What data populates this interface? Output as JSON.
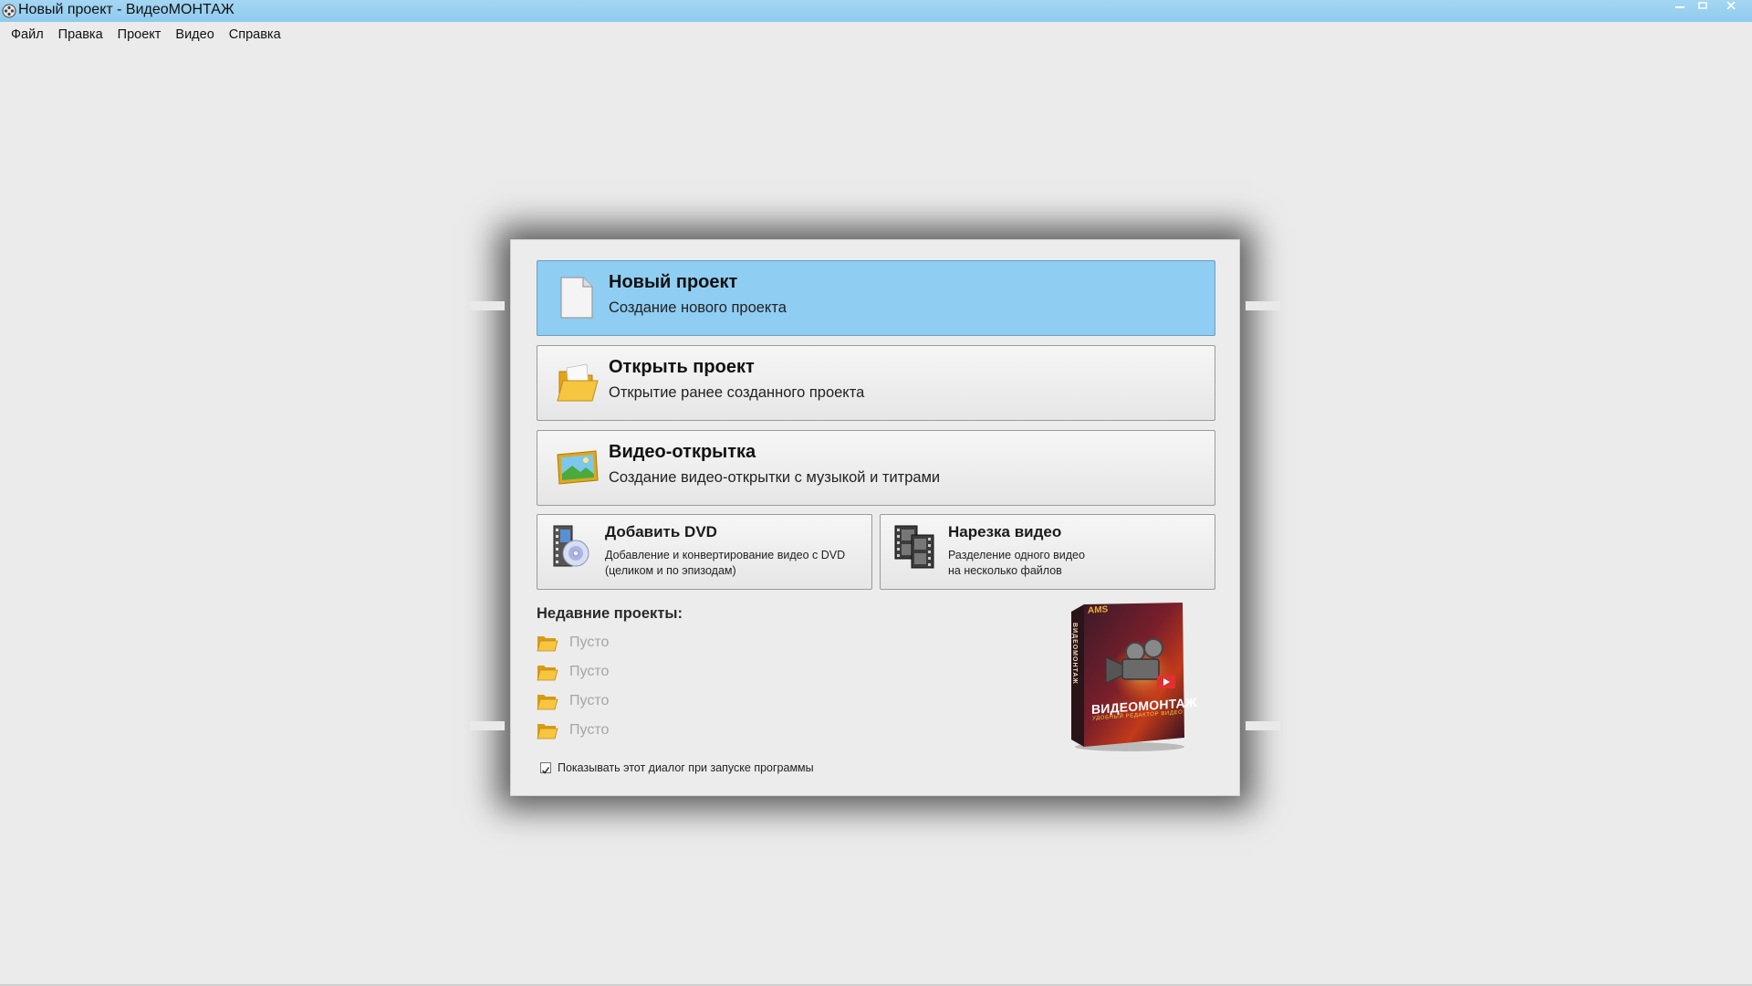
{
  "window": {
    "title": "Новый проект - ВидеоМОНТАЖ"
  },
  "menu": [
    {
      "label": "Файл"
    },
    {
      "label": "Правка"
    },
    {
      "label": "Проект"
    },
    {
      "label": "Видео"
    },
    {
      "label": "Справка"
    }
  ],
  "dialog": {
    "new_project": {
      "title": "Новый проект",
      "subtitle": "Создание нового проекта",
      "icon": "blank-document-icon",
      "selected": true
    },
    "open_project": {
      "title": "Открыть проект",
      "subtitle": "Открытие ранее созданного проекта",
      "icon": "folder-icon"
    },
    "video_card": {
      "title": "Видео-открытка",
      "subtitle": "Создание видео-открытки с музыкой и титрами",
      "icon": "picture-icon"
    },
    "add_dvd": {
      "title": "Добавить DVD",
      "subtitle_line1": "Добавление и конвертирование видео с DVD",
      "subtitle_line2": "(целиком и по эпизодам)",
      "icon": "dvd-film-icon"
    },
    "cut_video": {
      "title": "Нарезка видео",
      "subtitle_line1": "Разделение одного видео",
      "subtitle_line2": "на несколько файлов",
      "icon": "film-strips-icon"
    },
    "recent": {
      "heading": "Недавние проекты:",
      "items": [
        {
          "label": "Пусто"
        },
        {
          "label": "Пусто"
        },
        {
          "label": "Пусто"
        },
        {
          "label": "Пусто"
        }
      ]
    },
    "show_on_startup": {
      "label": "Показывать этот диалог при запуске программы",
      "checked": true
    },
    "product_box": {
      "brand": "ВИДЕОМОНТАЖ",
      "slogan": "УДОБНЫЙ РЕДАКТОР ВИДЕО",
      "publisher": "AMS",
      "spine": "ВИДЕОМОНТАЖ"
    }
  },
  "colors": {
    "titlebar": "#8ecbee",
    "selected_button": "#8fcdf2",
    "background": "#ebebeb"
  }
}
